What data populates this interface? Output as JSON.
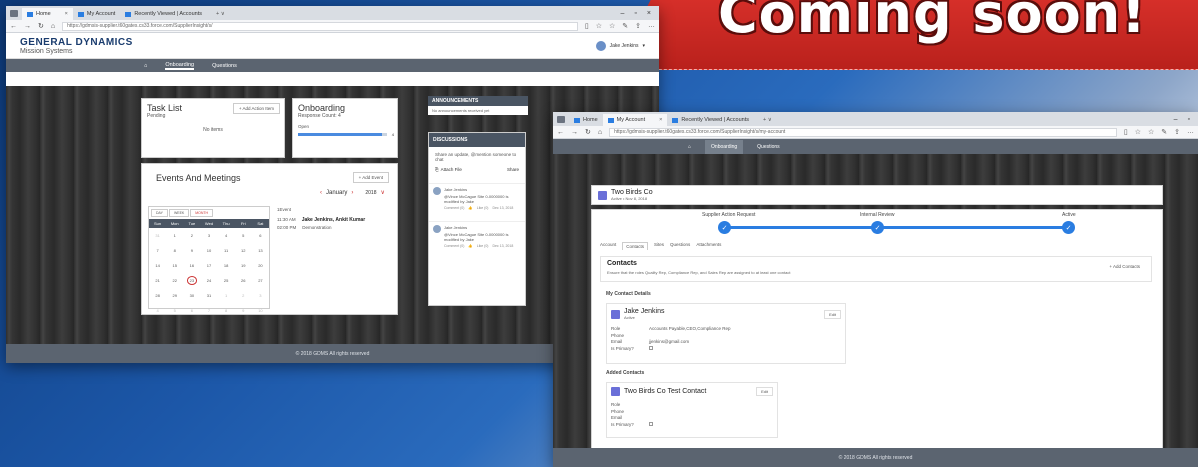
{
  "banner": {
    "text": "Coming soon!"
  },
  "window_left": {
    "tabs": [
      {
        "label": "Home",
        "active": true
      },
      {
        "label": "My Account",
        "active": false
      },
      {
        "label": "Recently Viewed | Accounts",
        "active": false
      }
    ],
    "url": "https://gdmsis-supplier.t60gates.cs33.force.com/SupplierInsight/s/",
    "logo": {
      "line1": "GENERAL DYNAMICS",
      "line2": "Mission Systems"
    },
    "user_name": "Jake Jenkins",
    "nav": {
      "home_icon": "home-icon",
      "items": [
        "Onboarding",
        "Questions"
      ]
    },
    "task_list": {
      "title": "Task List",
      "subtitle": "Pending",
      "button": "+ Add Action Item",
      "empty": "No items"
    },
    "onboarding": {
      "title": "Onboarding",
      "subtitle": "Response Count: 4",
      "status": "Open",
      "count": "4",
      "progress": 0.95
    },
    "events": {
      "title": "Events And Meetings",
      "button": "+ Add Event",
      "view_tabs": [
        "DAY",
        "WEEK",
        "MONTH"
      ],
      "month": "January",
      "year": "2018",
      "weekdays": [
        "Sun",
        "Mon",
        "Tue",
        "Wed",
        "Thu",
        "Fri",
        "Sat"
      ],
      "days": [
        [
          "31",
          "1",
          "2",
          "3",
          "4",
          "5",
          "6"
        ],
        [
          "7",
          "8",
          "9",
          "10",
          "11",
          "12",
          "13"
        ],
        [
          "14",
          "15",
          "16",
          "17",
          "18",
          "19",
          "20"
        ],
        [
          "21",
          "22",
          "23",
          "24",
          "25",
          "26",
          "27"
        ],
        [
          "28",
          "29",
          "30",
          "31",
          "1",
          "2",
          "3"
        ],
        [
          "4",
          "5",
          "6",
          "7",
          "8",
          "9",
          "10"
        ]
      ],
      "event_count": "1Event",
      "event_time": "11:30 AM",
      "event_title": "Jake Jenkins, Ankit Kumar",
      "event_time2": "02:00 PM",
      "event_type": "Demonstration"
    },
    "announcements": {
      "title": "ANNOUNCEMENTS",
      "body": "No announcements received yet"
    },
    "discussions": {
      "title": "DISCUSSIONS",
      "prompt": "Share an update, @mention someone to chat",
      "attach": "Attach File",
      "share": "Share",
      "posts": [
        {
          "author": "Jake Jenkins",
          "text": "@Vince McCague Site 0-0000000 is modified by Jake",
          "comment": "Comment (0)",
          "like": "Like (0)",
          "date": "Dec 13, 2018"
        },
        {
          "author": "Jake Jenkins",
          "text": "@Vince McCague Site 0-0000000 is modified by Jake",
          "comment": "Comment (0)",
          "like": "Like (0)",
          "date": "Dec 13, 2018"
        }
      ]
    },
    "footer": "© 2018 GDMS All rights reserved"
  },
  "window_right": {
    "tabs": [
      {
        "label": "Home",
        "active": false
      },
      {
        "label": "My Account",
        "active": true
      },
      {
        "label": "Recently Viewed | Accounts",
        "active": false
      }
    ],
    "url": "https://gdmsis-supplier.t60gates.cs33.force.com/SupplierInsight/s/my-account",
    "nav": {
      "home_icon": "home-icon",
      "items": [
        "Onboarding",
        "Questions"
      ]
    },
    "account": {
      "name": "Two Birds Co",
      "status": "Active • Nov 8, 2018"
    },
    "path": {
      "steps": [
        "Supplier Action Request",
        "Internal Review",
        "Active"
      ]
    },
    "record_tabs": [
      "Account",
      "Contacts",
      "Sites",
      "Questions",
      "Attachments"
    ],
    "contacts": {
      "title": "Contacts",
      "add_button": "+ Add Contacts",
      "description": "Ensure that the roles Quality Rep, Compliance Rep, and Sales Rep are assigned to at least one contact",
      "my_details_title": "My Contact Details",
      "my_contact": {
        "name": "Jake Jenkins",
        "status": "Active",
        "edit": "Edit",
        "fields": [
          {
            "k": "Role",
            "v": "Accounts Payable,CEO,Compliance Rep"
          },
          {
            "k": "Phone",
            "v": ""
          },
          {
            "k": "Email",
            "v": "jjenkins@gmail.com"
          },
          {
            "k": "Is Primary?",
            "v": ""
          }
        ]
      },
      "added_title": "Added Contacts",
      "added_contact": {
        "name": "Two Birds Co Test Contact",
        "edit": "Edit",
        "fields": [
          {
            "k": "Role",
            "v": ""
          },
          {
            "k": "Phone",
            "v": ""
          },
          {
            "k": "Email",
            "v": ""
          },
          {
            "k": "Is Primary?",
            "v": ""
          }
        ]
      }
    },
    "footer": "© 2018 GDMS All rights reserved"
  },
  "colors": {
    "banner_red": "#d42a25",
    "nav_gray": "#5b6470",
    "accent_blue": "#2a7de1"
  }
}
